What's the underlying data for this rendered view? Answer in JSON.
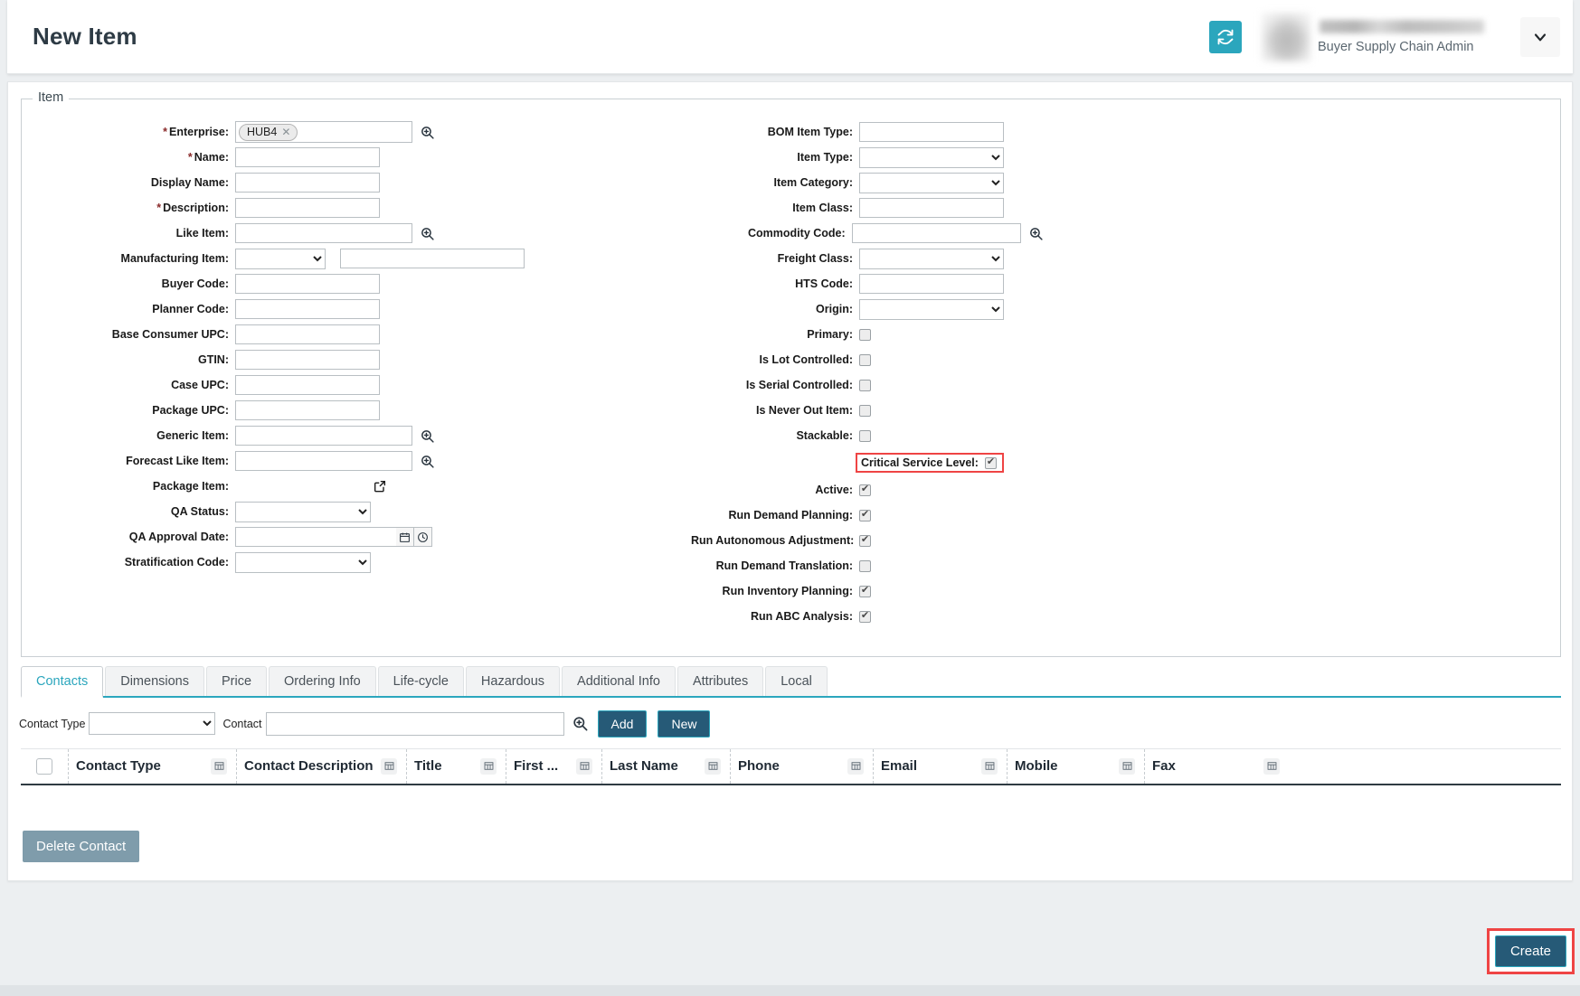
{
  "header": {
    "title": "New Item",
    "refresh_icon": "refresh-icon",
    "user_role": "Buyer Supply Chain Admin",
    "caret_icon": "chevron-down-icon",
    "accent_teal": "#2ba6bd",
    "navy": "#265a77",
    "highlight_red": "#ef4444"
  },
  "item_section": {
    "legend": "Item",
    "left_fields": [
      {
        "label": "Enterprise:",
        "required": true,
        "type": "chip",
        "chip_value": "HUB4",
        "has_search_icon": true
      },
      {
        "label": "Name:",
        "required": true,
        "type": "text",
        "value": ""
      },
      {
        "label": "Display Name:",
        "required": false,
        "type": "text",
        "value": ""
      },
      {
        "label": "Description:",
        "required": true,
        "type": "text",
        "value": ""
      },
      {
        "label": "Like Item:",
        "required": false,
        "type": "text",
        "value": "",
        "has_search_icon": true
      },
      {
        "label": "Manufacturing Item:",
        "required": false,
        "type": "select_plus_text",
        "value": ""
      },
      {
        "label": "Buyer Code:",
        "required": false,
        "type": "text",
        "value": ""
      },
      {
        "label": "Planner Code:",
        "required": false,
        "type": "text",
        "value": ""
      },
      {
        "label": "Base Consumer UPC:",
        "required": false,
        "type": "text",
        "value": ""
      },
      {
        "label": "GTIN:",
        "required": false,
        "type": "text",
        "value": ""
      },
      {
        "label": "Case UPC:",
        "required": false,
        "type": "text",
        "value": ""
      },
      {
        "label": "Package UPC:",
        "required": false,
        "type": "text",
        "value": ""
      },
      {
        "label": "Generic Item:",
        "required": false,
        "type": "text",
        "value": "",
        "has_search_icon": true
      },
      {
        "label": "Forecast Like Item:",
        "required": false,
        "type": "text",
        "value": "",
        "has_search_icon": true
      },
      {
        "label": "Package Item:",
        "required": false,
        "type": "external_link"
      },
      {
        "label": "QA Status:",
        "required": false,
        "type": "select",
        "value": ""
      },
      {
        "label": "QA Approval Date:",
        "required": false,
        "type": "date",
        "value": ""
      },
      {
        "label": "Stratification Code:",
        "required": false,
        "type": "select",
        "value": ""
      }
    ],
    "right_fields": [
      {
        "label": "BOM Item Type:",
        "type": "text",
        "value": ""
      },
      {
        "label": "Item Type:",
        "type": "select",
        "value": ""
      },
      {
        "label": "Item Category:",
        "type": "select",
        "value": ""
      },
      {
        "label": "Item Class:",
        "type": "text",
        "value": ""
      },
      {
        "label": "Commodity Code:",
        "type": "text",
        "value": "",
        "has_search_icon": true
      },
      {
        "label": "Freight Class:",
        "type": "select",
        "value": ""
      },
      {
        "label": "HTS Code:",
        "type": "text",
        "value": ""
      },
      {
        "label": "Origin:",
        "type": "select",
        "value": ""
      },
      {
        "label": "Primary:",
        "type": "checkbox",
        "checked": false
      },
      {
        "label": "Is Lot Controlled:",
        "type": "checkbox",
        "checked": false
      },
      {
        "label": "Is Serial Controlled:",
        "type": "checkbox",
        "checked": false
      },
      {
        "label": "Is Never Out Item:",
        "type": "checkbox",
        "checked": false
      },
      {
        "label": "Stackable:",
        "type": "checkbox",
        "checked": false
      },
      {
        "label": "Critical Service Level:",
        "type": "checkbox",
        "checked": true,
        "highlighted": true
      },
      {
        "label": "Active:",
        "type": "checkbox",
        "checked": true
      },
      {
        "label": "Run Demand Planning:",
        "type": "checkbox",
        "checked": true
      },
      {
        "label": "Run Autonomous Adjustment:",
        "type": "checkbox",
        "checked": true
      },
      {
        "label": "Run Demand Translation:",
        "type": "checkbox",
        "checked": false
      },
      {
        "label": "Run Inventory Planning:",
        "type": "checkbox",
        "checked": true
      },
      {
        "label": "Run ABC Analysis:",
        "type": "checkbox",
        "checked": true
      }
    ]
  },
  "tabs": [
    {
      "label": "Contacts",
      "active": true
    },
    {
      "label": "Dimensions",
      "active": false
    },
    {
      "label": "Price",
      "active": false
    },
    {
      "label": "Ordering Info",
      "active": false
    },
    {
      "label": "Life-cycle",
      "active": false
    },
    {
      "label": "Hazardous",
      "active": false
    },
    {
      "label": "Additional Info",
      "active": false
    },
    {
      "label": "Attributes",
      "active": false
    },
    {
      "label": "Local",
      "active": false
    }
  ],
  "contacts_panel": {
    "contact_type_label": "Contact Type",
    "contact_type_value": "",
    "contact_label": "Contact",
    "contact_value": "",
    "search_icon": "search-icon",
    "add_label": "Add",
    "new_label": "New",
    "columns": [
      "Contact Type",
      "Contact Description",
      "Title",
      "First ...",
      "Last Name",
      "Phone",
      "Email",
      "Mobile",
      "Fax"
    ],
    "rows": [],
    "delete_label": "Delete Contact"
  },
  "footer": {
    "create_label": "Create"
  }
}
